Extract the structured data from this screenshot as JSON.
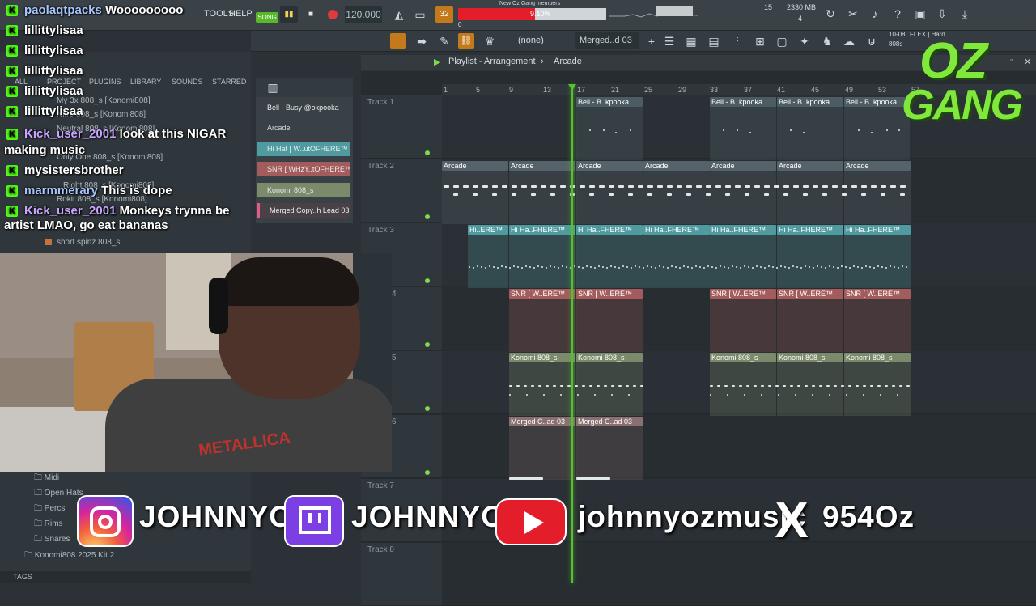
{
  "menu": {
    "tools": "TOOLS",
    "help": "HELP",
    "song": "SONG",
    "bpm": "120.000",
    "counter": "32"
  },
  "hint": {
    "title": "New Oz Gang members",
    "progress": "9.10%",
    "progress_value": 0.091,
    "zero": "0"
  },
  "stats": {
    "mem": "2330 MB",
    "cpu": "15",
    "voices": "4"
  },
  "toolbar2": {
    "preset": "(none)",
    "pattern": "Merged..d 03",
    "date": "10-08",
    "flex": "FLEX | Hard",
    "sub": "808s"
  },
  "playlist": {
    "title": "Playlist - Arrangement",
    "crumb": "Arcade"
  },
  "ruler": [
    "1",
    "5",
    "9",
    "13",
    "17",
    "21",
    "25",
    "29",
    "33",
    "37",
    "41",
    "45",
    "49",
    "53",
    "57"
  ],
  "tracks": [
    "Track 1",
    "Track 2",
    "Track 3",
    "4",
    "5",
    "6",
    "Track 7",
    "Track 8"
  ],
  "channels": [
    "Bell - Busy @okpooka",
    "Arcade",
    "Hi Hat [ W..utOFHERE™ ]",
    "SNR [ WHzY..tOFHERE™ ]",
    "Konomi 808_s",
    "Merged Copy..h Lead 03"
  ],
  "clips": {
    "bell": "Bell - B..kpooka",
    "arcade": "Arcade",
    "hihat": "Hi Ha..FHERE™",
    "hihat_first": "Hi..ERE™",
    "snr": "SNR [ W..ERE™",
    "konomi": "Konomi 808_s",
    "merged": "Merged C..ad 03"
  },
  "browser": {
    "tabs": [
      "ALL",
      "PROJECT",
      "PLUGINS",
      "LIBRARY",
      "SOUNDS",
      "STARRED"
    ],
    "items": [
      "My 3x 808_s [Konomi808]",
      "Nitro 808_s [Konomi808]",
      "Neutral 808_s [Konomi808]",
      "Only One 808_s [Konomi808]",
      "Right 808_s [Konomi808]",
      "Rokit 808_s [Konomi808]",
      "short spinz 808_s"
    ],
    "folders": [
      "Midi",
      "Open Hats",
      "Percs",
      "Rims",
      "Snares",
      "Konomi808 2025 Kit 2"
    ],
    "tags": "TAGS"
  },
  "chat": [
    {
      "user": "paolaqtpacks",
      "msg": "Wooooooooo",
      "color": "b"
    },
    {
      "user": "lillittylisaa",
      "msg": "",
      "color": ""
    },
    {
      "user": "lillittylisaa",
      "msg": "",
      "color": ""
    },
    {
      "user": "lillittylisaa",
      "msg": "",
      "color": ""
    },
    {
      "user": "lillittylisaa",
      "msg": "",
      "color": ""
    },
    {
      "user": "lillittylisaa",
      "msg": "",
      "color": ""
    },
    {
      "user": "Kick_user_2001",
      "msg": "look at this NIGAR",
      "color": "p"
    },
    {
      "user": "",
      "msg": "making music",
      "color": ""
    },
    {
      "user": "mysistersbrother",
      "msg": "",
      "color": ""
    },
    {
      "user": "marmmerary",
      "msg": "This is dope",
      "color": "b"
    },
    {
      "user": "Kick_user_2001",
      "msg": "Monkeys trynna be",
      "color": "p"
    },
    {
      "user": "",
      "msg": "artist LMAO, go eat bananas",
      "color": ""
    }
  ],
  "socials": {
    "instagram": "JOHNNYOZ",
    "twitch": "JOHNNYOZ",
    "youtube": "johnnyozmusic",
    "x": "954Oz"
  },
  "logo": {
    "line1": "OZ",
    "line2": "GANG"
  },
  "shirt": "METALLICA",
  "colors": {
    "playhead": "#57c12d",
    "kick": "#53fc18",
    "accent_red": "#e31d2a"
  }
}
